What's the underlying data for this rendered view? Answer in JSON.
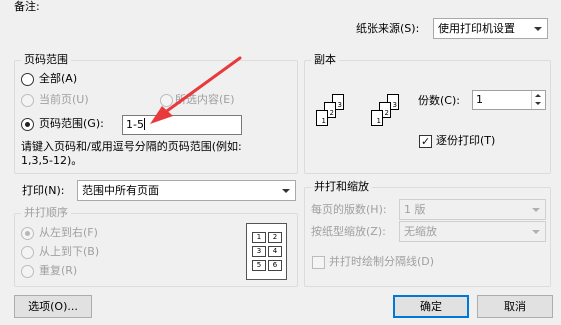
{
  "notes_label": "备注:",
  "paper_source": {
    "label": "纸张来源(S):",
    "value": "使用打印机设置"
  },
  "page_range": {
    "title": "页码范围",
    "all_label": "全部(A)",
    "current_label": "当前页(U)",
    "selection_label": "所选内容(E)",
    "pages_label": "页码范围(G):",
    "pages_value": "1-5",
    "hint_line1": "请键入页码和/或用逗号分隔的页码范围(例如:",
    "hint_line2": "1,3,5-12)。",
    "selected": "pages"
  },
  "copies": {
    "title": "副本",
    "count_label": "份数(C):",
    "count_value": "1",
    "collate_label": "逐份打印(T)",
    "collate_checked": true
  },
  "print_what": {
    "label": "打印(N):",
    "value": "范围中所有页面"
  },
  "print_order": {
    "title": "并打顺序",
    "left_to_right": "从左到右(F)",
    "top_to_bottom": "从上到下(B)",
    "repeat": "重复(R)",
    "selected": "left_to_right",
    "preview_cells": [
      "1",
      "2",
      "3",
      "4",
      "5",
      "6"
    ]
  },
  "zoom": {
    "title": "并打和缩放",
    "pages_per_sheet_label": "每页的版数(H):",
    "pages_per_sheet_value": "1 版",
    "scale_label": "按纸型缩放(Z):",
    "scale_value": "无缩放",
    "draw_borders_label": "并打时绘制分隔线(D)",
    "draw_borders_checked": false
  },
  "buttons": {
    "options": "选项(O)...",
    "ok": "确定",
    "cancel": "取消"
  },
  "colors": {
    "annotation_arrow": "#e8393c",
    "accent": "#0078d7"
  },
  "copies_preview_pages": [
    "1",
    "2",
    "3"
  ]
}
